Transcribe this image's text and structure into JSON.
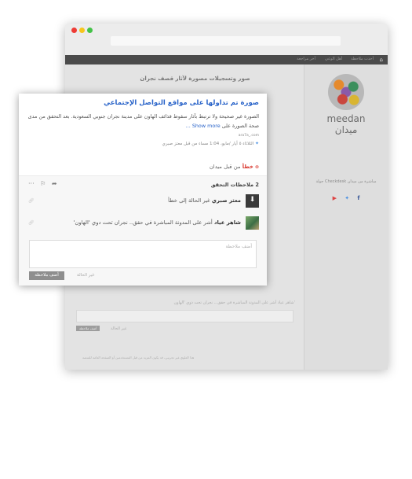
{
  "app": {
    "nav_items": [
      "أحدث ملاحظة",
      "أهل الوعي",
      "آخر مراجعة"
    ],
    "logo": {
      "en": "meedan",
      "ar": "ميدان"
    },
    "sidebar_text": "جولة Checkdesk مباشرة من ميدان",
    "background_title": "صور وتسجيلات مصورة لآثار قصف نجران",
    "background_notes": [
      "شاهر عياد أشر على المدونة المباشرة في حقق... نجران تحت دوي 'الهاون'",
      "أضف ملاحظة"
    ],
    "background_add_button": "أضف ملاحظة",
    "background_change_status": "غير الحالة",
    "background_footer": "هذا العلوي غير تجريبي، قد يكون المزيد من قبل المستخدمين أو الصفحة العامة للمنصة"
  },
  "card": {
    "title": "صورة تم تداولها على مواقع التواصل الإجتماعي",
    "description": "الصورة غير صحيحة ولا ترتبط بآثار سقوط قذائف الهاون على مدينة نجران جنوبي السعودية. بعد التحقق من مدى صحة الصورة على",
    "show_more": "Show more ...",
    "source": "ara7a_.com",
    "meta": "الثلاثاء ٥ أيار /مايو، 1:04 مساء من قبل معتز صبري",
    "status": {
      "word": "خطأ",
      "by": "من قبل ميدان"
    }
  },
  "notes": {
    "count_label": "2 ملاحظات التحقق",
    "items": [
      {
        "name": "معتز صبري",
        "text": "غير الحالة إلى خطأ"
      },
      {
        "name": "شاهر عياد",
        "text": "أشر على المدونة المباشرة في حقق.. نجران تحت دوي 'الهاون'"
      }
    ],
    "input_placeholder": "أضف ملاحظة",
    "add_button": "أضف ملاحظة",
    "change_status": "غير الحالة"
  },
  "icons": {
    "share": "share-icon",
    "flag": "flag-icon",
    "more": "more-icon",
    "twitter": "twitter-icon",
    "status": "error-icon",
    "link": "link-icon"
  },
  "colors": {
    "accent": "#2a64c9",
    "error": "#d9382f",
    "button": "#8e8e8e"
  }
}
